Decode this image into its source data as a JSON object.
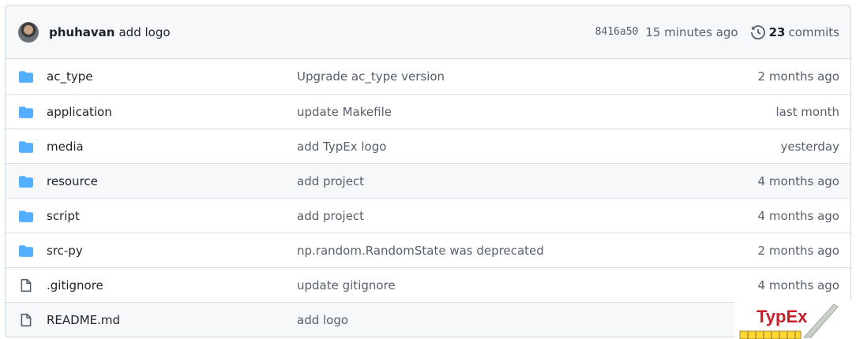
{
  "latest_commit": {
    "author": "phuhavan",
    "message": "add logo",
    "sha": "8416a50",
    "time": "15 minutes ago",
    "commit_count": "23",
    "commits_label": "commits"
  },
  "files": [
    {
      "name": "ac_type",
      "type": "folder",
      "message": "Upgrade ac_type version",
      "age": "2 months ago"
    },
    {
      "name": "application",
      "type": "folder",
      "message": "update Makefile",
      "age": "last month"
    },
    {
      "name": "media",
      "type": "folder",
      "message": "add TypEx logo",
      "age": "yesterday"
    },
    {
      "name": "resource",
      "type": "folder",
      "message": "add project",
      "age": "4 months ago"
    },
    {
      "name": "script",
      "type": "folder",
      "message": "add project",
      "age": "4 months ago"
    },
    {
      "name": "src-py",
      "type": "folder",
      "message": "np.random.RandomState was deprecated",
      "age": "2 months ago"
    },
    {
      "name": ".gitignore",
      "type": "file",
      "message": "update gitignore",
      "age": "4 months ago"
    },
    {
      "name": "README.md",
      "type": "file",
      "message": "add logo",
      "age": ""
    }
  ],
  "overlay_logo": {
    "text": "TypEx",
    "text_color": "#c8202a"
  },
  "colors": {
    "folder": "#54aeff",
    "muted": "#57606a",
    "border": "#d0d7de"
  },
  "icons": {
    "history": "history-icon",
    "folder": "folder-icon",
    "file": "file-icon"
  }
}
